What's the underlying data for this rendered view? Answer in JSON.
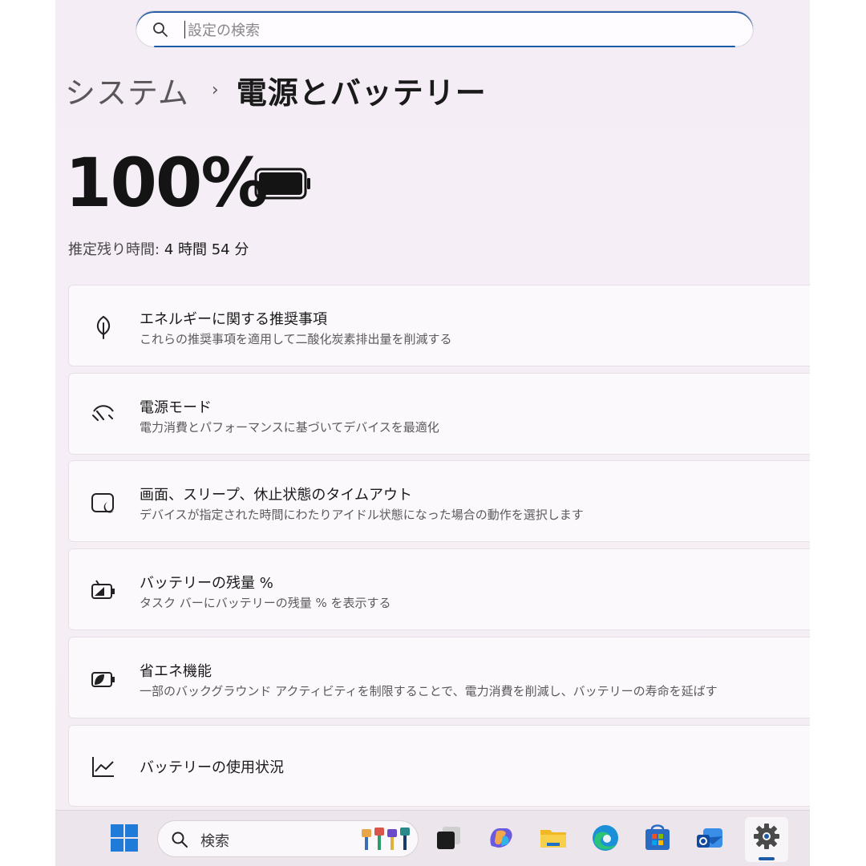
{
  "search": {
    "placeholder": "設定の検索"
  },
  "breadcrumb": {
    "parent": "システム",
    "separator": "›",
    "current": "電源とバッテリー"
  },
  "battery": {
    "percent_text": "100%",
    "level": 1.0,
    "remaining_label": "推定残り時間:",
    "remaining_value": "4 時間 54 分"
  },
  "cards": [
    {
      "icon": "leaf-icon",
      "title": "エネルギーに関する推奨事項",
      "desc": "これらの推奨事項を適用して二酸化炭素排出量を削減する"
    },
    {
      "icon": "power-mode-gauge-icon",
      "title": "電源モード",
      "desc": "電力消費とパフォーマンスに基づいてデバイスを最適化"
    },
    {
      "icon": "screen-sleep-icon",
      "title": "画面、スリープ、休止状態のタイムアウト",
      "desc": "デバイスが指定された時間にわたりアイドル状態になった場合の動作を選択します"
    },
    {
      "icon": "battery-percentage-icon",
      "title": "バッテリーの残量 %",
      "desc": "タスク バーにバッテリーの残量 % を表示する"
    },
    {
      "icon": "energy-saver-icon",
      "title": "省エネ機能",
      "desc": "一部のバックグラウンド アクティビティを制限することで、電力消費を削減し、バッテリーの寿命を延ばす"
    },
    {
      "icon": "usage-chart-icon",
      "title": "バッテリーの使用状況",
      "desc": ""
    }
  ],
  "taskbar": {
    "search_label": "検索",
    "apps": [
      "windows-start-icon",
      "task-view-icon",
      "copilot-icon",
      "file-explorer-icon",
      "edge-icon",
      "store-icon",
      "outlook-icon",
      "settings-icon"
    ]
  },
  "colors": {
    "accent": "#1f5aa6",
    "background": "#f5edf5",
    "card": "#fcf9fc"
  }
}
